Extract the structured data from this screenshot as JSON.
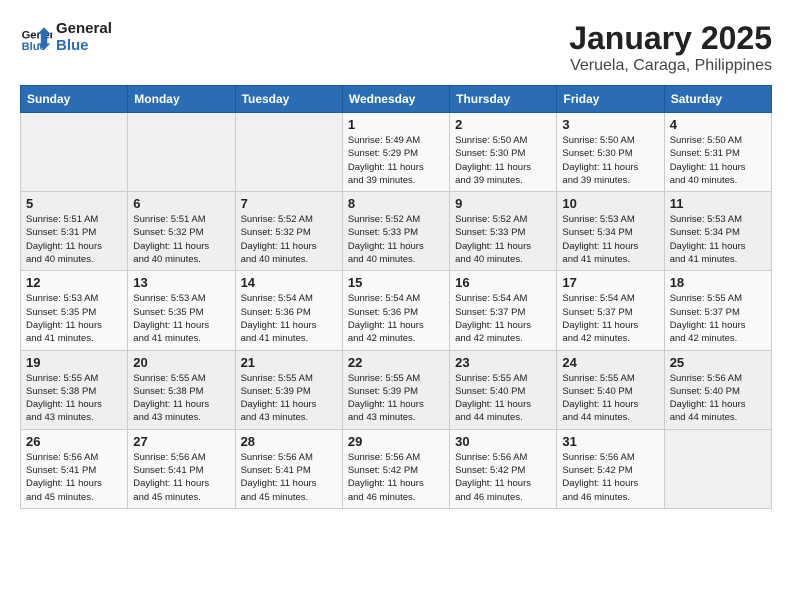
{
  "header": {
    "logo_line1": "General",
    "logo_line2": "Blue",
    "month": "January 2025",
    "location": "Veruela, Caraga, Philippines"
  },
  "weekdays": [
    "Sunday",
    "Monday",
    "Tuesday",
    "Wednesday",
    "Thursday",
    "Friday",
    "Saturday"
  ],
  "weeks": [
    [
      {
        "day": "",
        "info": ""
      },
      {
        "day": "",
        "info": ""
      },
      {
        "day": "",
        "info": ""
      },
      {
        "day": "1",
        "info": "Sunrise: 5:49 AM\nSunset: 5:29 PM\nDaylight: 11 hours\nand 39 minutes."
      },
      {
        "day": "2",
        "info": "Sunrise: 5:50 AM\nSunset: 5:30 PM\nDaylight: 11 hours\nand 39 minutes."
      },
      {
        "day": "3",
        "info": "Sunrise: 5:50 AM\nSunset: 5:30 PM\nDaylight: 11 hours\nand 39 minutes."
      },
      {
        "day": "4",
        "info": "Sunrise: 5:50 AM\nSunset: 5:31 PM\nDaylight: 11 hours\nand 40 minutes."
      }
    ],
    [
      {
        "day": "5",
        "info": "Sunrise: 5:51 AM\nSunset: 5:31 PM\nDaylight: 11 hours\nand 40 minutes."
      },
      {
        "day": "6",
        "info": "Sunrise: 5:51 AM\nSunset: 5:32 PM\nDaylight: 11 hours\nand 40 minutes."
      },
      {
        "day": "7",
        "info": "Sunrise: 5:52 AM\nSunset: 5:32 PM\nDaylight: 11 hours\nand 40 minutes."
      },
      {
        "day": "8",
        "info": "Sunrise: 5:52 AM\nSunset: 5:33 PM\nDaylight: 11 hours\nand 40 minutes."
      },
      {
        "day": "9",
        "info": "Sunrise: 5:52 AM\nSunset: 5:33 PM\nDaylight: 11 hours\nand 40 minutes."
      },
      {
        "day": "10",
        "info": "Sunrise: 5:53 AM\nSunset: 5:34 PM\nDaylight: 11 hours\nand 41 minutes."
      },
      {
        "day": "11",
        "info": "Sunrise: 5:53 AM\nSunset: 5:34 PM\nDaylight: 11 hours\nand 41 minutes."
      }
    ],
    [
      {
        "day": "12",
        "info": "Sunrise: 5:53 AM\nSunset: 5:35 PM\nDaylight: 11 hours\nand 41 minutes."
      },
      {
        "day": "13",
        "info": "Sunrise: 5:53 AM\nSunset: 5:35 PM\nDaylight: 11 hours\nand 41 minutes."
      },
      {
        "day": "14",
        "info": "Sunrise: 5:54 AM\nSunset: 5:36 PM\nDaylight: 11 hours\nand 41 minutes."
      },
      {
        "day": "15",
        "info": "Sunrise: 5:54 AM\nSunset: 5:36 PM\nDaylight: 11 hours\nand 42 minutes."
      },
      {
        "day": "16",
        "info": "Sunrise: 5:54 AM\nSunset: 5:37 PM\nDaylight: 11 hours\nand 42 minutes."
      },
      {
        "day": "17",
        "info": "Sunrise: 5:54 AM\nSunset: 5:37 PM\nDaylight: 11 hours\nand 42 minutes."
      },
      {
        "day": "18",
        "info": "Sunrise: 5:55 AM\nSunset: 5:37 PM\nDaylight: 11 hours\nand 42 minutes."
      }
    ],
    [
      {
        "day": "19",
        "info": "Sunrise: 5:55 AM\nSunset: 5:38 PM\nDaylight: 11 hours\nand 43 minutes."
      },
      {
        "day": "20",
        "info": "Sunrise: 5:55 AM\nSunset: 5:38 PM\nDaylight: 11 hours\nand 43 minutes."
      },
      {
        "day": "21",
        "info": "Sunrise: 5:55 AM\nSunset: 5:39 PM\nDaylight: 11 hours\nand 43 minutes."
      },
      {
        "day": "22",
        "info": "Sunrise: 5:55 AM\nSunset: 5:39 PM\nDaylight: 11 hours\nand 43 minutes."
      },
      {
        "day": "23",
        "info": "Sunrise: 5:55 AM\nSunset: 5:40 PM\nDaylight: 11 hours\nand 44 minutes."
      },
      {
        "day": "24",
        "info": "Sunrise: 5:55 AM\nSunset: 5:40 PM\nDaylight: 11 hours\nand 44 minutes."
      },
      {
        "day": "25",
        "info": "Sunrise: 5:56 AM\nSunset: 5:40 PM\nDaylight: 11 hours\nand 44 minutes."
      }
    ],
    [
      {
        "day": "26",
        "info": "Sunrise: 5:56 AM\nSunset: 5:41 PM\nDaylight: 11 hours\nand 45 minutes."
      },
      {
        "day": "27",
        "info": "Sunrise: 5:56 AM\nSunset: 5:41 PM\nDaylight: 11 hours\nand 45 minutes."
      },
      {
        "day": "28",
        "info": "Sunrise: 5:56 AM\nSunset: 5:41 PM\nDaylight: 11 hours\nand 45 minutes."
      },
      {
        "day": "29",
        "info": "Sunrise: 5:56 AM\nSunset: 5:42 PM\nDaylight: 11 hours\nand 46 minutes."
      },
      {
        "day": "30",
        "info": "Sunrise: 5:56 AM\nSunset: 5:42 PM\nDaylight: 11 hours\nand 46 minutes."
      },
      {
        "day": "31",
        "info": "Sunrise: 5:56 AM\nSunset: 5:42 PM\nDaylight: 11 hours\nand 46 minutes."
      },
      {
        "day": "",
        "info": ""
      }
    ]
  ]
}
